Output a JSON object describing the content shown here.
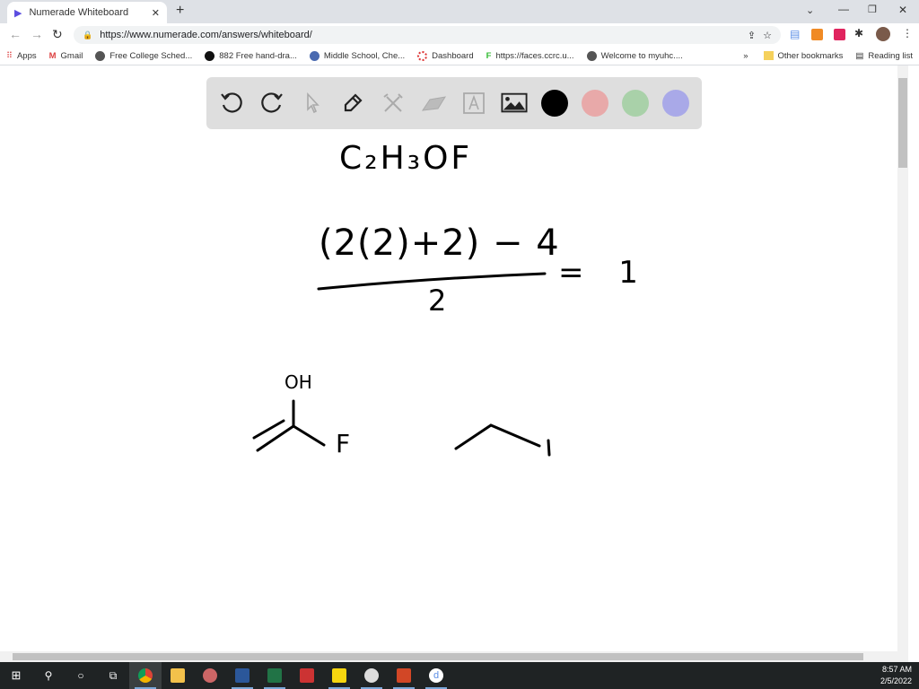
{
  "browser": {
    "tab_title": "Numerade Whiteboard",
    "new_tab": "+",
    "url": "https://www.numerade.com/answers/whiteboard/",
    "bookmarks": [
      {
        "label": "Apps",
        "icon": "apps-grid-icon"
      },
      {
        "label": "Gmail",
        "icon": "gmail-icon"
      },
      {
        "label": "Free College Sched...",
        "icon": "globe-icon"
      },
      {
        "label": "882 Free hand-dra...",
        "icon": "site-icon"
      },
      {
        "label": "Middle School, Che...",
        "icon": "site-icon"
      },
      {
        "label": "Dashboard",
        "icon": "dashboard-icon"
      },
      {
        "label": "https://faces.ccrc.u...",
        "icon": "faces-icon"
      },
      {
        "label": "Welcome to myuhc....",
        "icon": "globe-icon"
      }
    ],
    "overflow": "»",
    "other_bookmarks": "Other bookmarks",
    "reading_list": "Reading list"
  },
  "toolbar": {
    "tools": [
      "undo",
      "redo",
      "select",
      "pen",
      "tools",
      "eraser",
      "text",
      "image"
    ],
    "colors": [
      "#000000",
      "#e8a9a9",
      "#a9d1a9",
      "#a9a9e8"
    ]
  },
  "whiteboard": {
    "formula": "C₂H₃OF",
    "numerator": "(2(2)+2) − 4",
    "denominator": "2",
    "result": "= 1",
    "oh_label": "OH",
    "f_label": "F"
  },
  "taskbar": {
    "time": "8:57 AM",
    "date": "2/5/2022"
  }
}
